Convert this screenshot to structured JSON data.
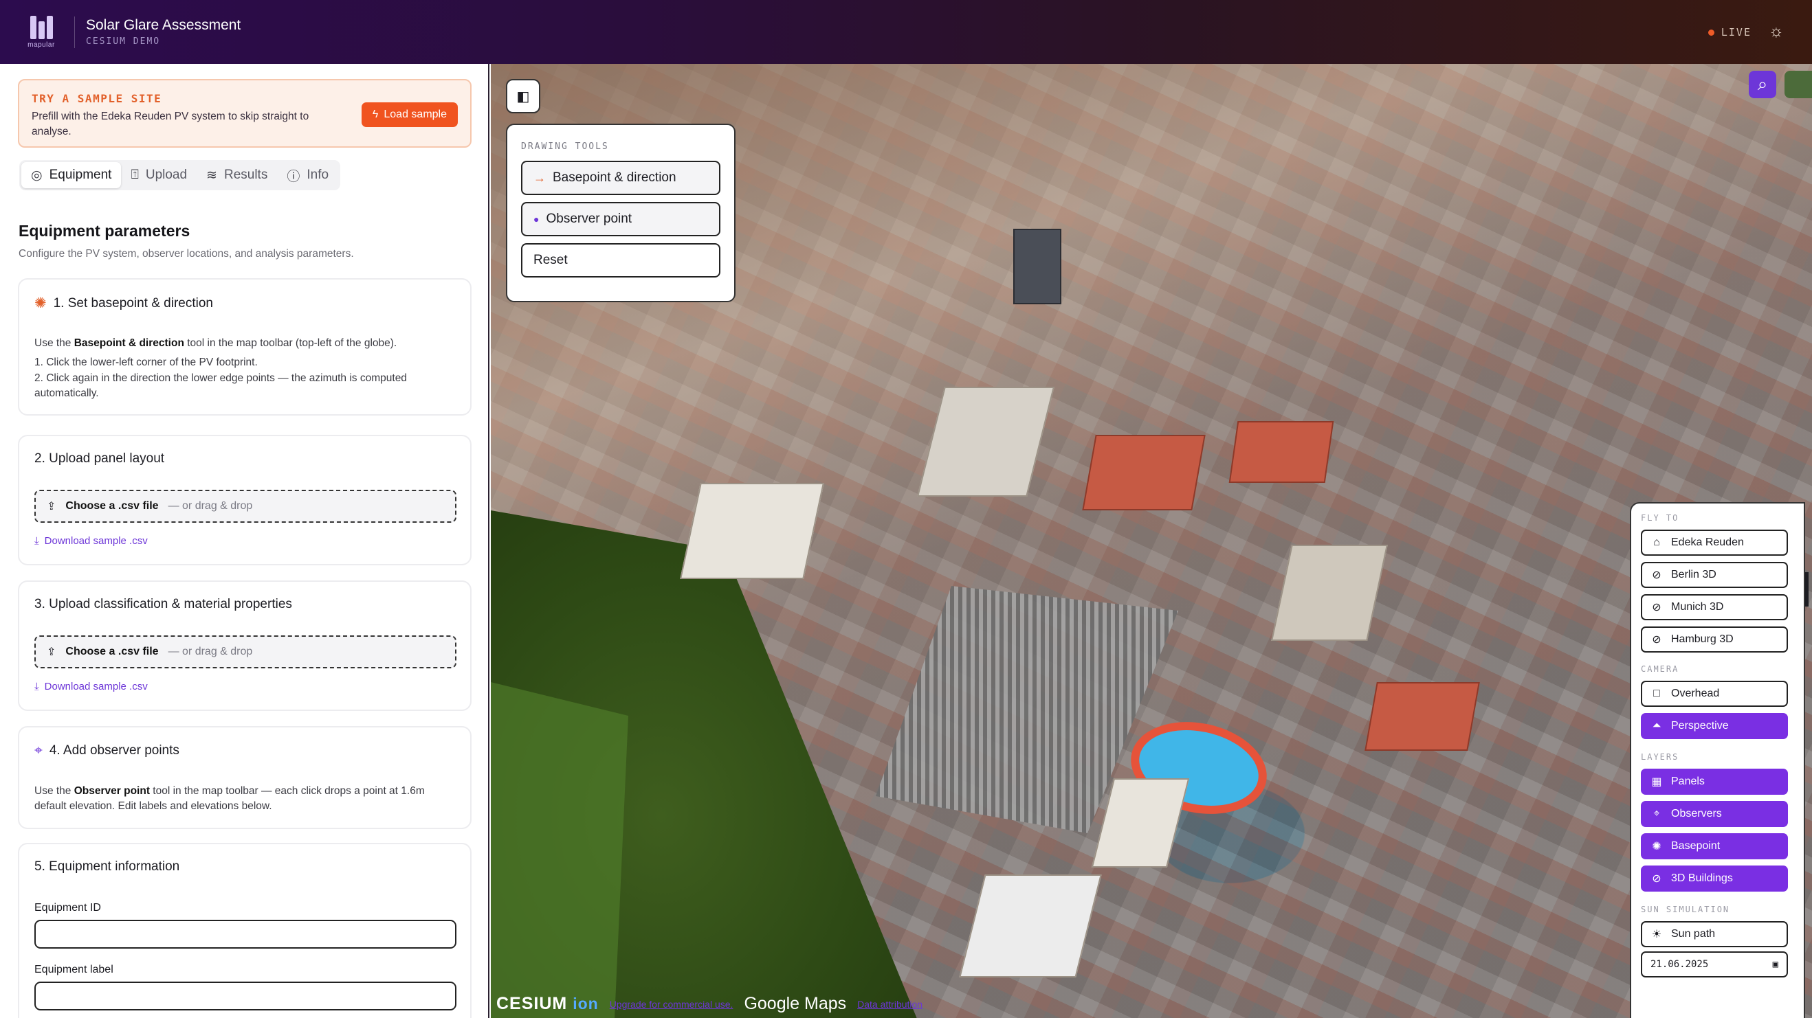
{
  "header": {
    "logo_text": "mapular",
    "title": "Solar Glare Assessment",
    "subtitle": "CESIUM DEMO",
    "live_label": "LIVE",
    "theme_icon": "sun-icon"
  },
  "banner": {
    "title": "TRY A SAMPLE SITE",
    "text": "Prefill with the Edeka Reuden PV system to skip straight to analyse.",
    "button": "Load sample"
  },
  "tabs": [
    {
      "label": "Equipment",
      "icon": "target-icon"
    },
    {
      "label": "Upload",
      "icon": "upload-file-icon"
    },
    {
      "label": "Results",
      "icon": "layers-icon"
    },
    {
      "label": "Info",
      "icon": "info-icon"
    }
  ],
  "equipment": {
    "title": "Equipment parameters",
    "description": "Configure the PV system, observer locations, and analysis parameters.",
    "step1": {
      "title": "1. Set basepoint & direction",
      "intro_pre": "Use the ",
      "intro_bold": "Basepoint & direction",
      "intro_post": " tool in the map toolbar (top-left of the globe).",
      "item1": "1. Click the lower-left corner of the PV footprint.",
      "item2": "2. Click again in the direction the lower edge points — the azimuth is computed automatically."
    },
    "step2": {
      "title": "2. Upload panel layout",
      "choose": "Choose a .csv file",
      "drag": "— or drag & drop",
      "download": "Download sample .csv"
    },
    "step3": {
      "title": "3. Upload classification & material properties",
      "choose": "Choose a .csv file",
      "drag": "— or drag & drop",
      "download": "Download sample .csv"
    },
    "step4": {
      "title": "4. Add observer points",
      "text_pre": "Use the ",
      "text_bold": "Observer point",
      "text_post": " tool in the map toolbar — each click drops a point at 1.6m default elevation. Edit labels and elevations below."
    },
    "step5": {
      "title": "5. Equipment information",
      "id_label": "Equipment ID",
      "id_value": "",
      "label_label": "Equipment label",
      "label_value": ""
    }
  },
  "drawing_tools": {
    "title": "DRAWING TOOLS",
    "basepoint": "Basepoint & direction",
    "observer": "Observer point",
    "reset": "Reset"
  },
  "sidebar": {
    "fly_to": "FLY TO",
    "fly_items": [
      "Edeka Reuden",
      "Berlin 3D",
      "Munich 3D",
      "Hamburg 3D"
    ],
    "camera": "CAMERA",
    "camera_items": [
      "Overhead",
      "Perspective"
    ],
    "layers": "LAYERS",
    "layer_items": [
      "Panels",
      "Observers",
      "Basepoint",
      "3D Buildings"
    ],
    "sun": "SUN SIMULATION",
    "sun_path": "Sun path",
    "date": "21.06.2025"
  },
  "attribution": {
    "cesium": "CESIUM",
    "ion": "ion",
    "cesium_link": "Upgrade for commercial use.",
    "google": "Google Maps",
    "data_link": "Data attribution"
  },
  "colors": {
    "accent": "#7a2fe3",
    "orange": "#f0531f"
  }
}
